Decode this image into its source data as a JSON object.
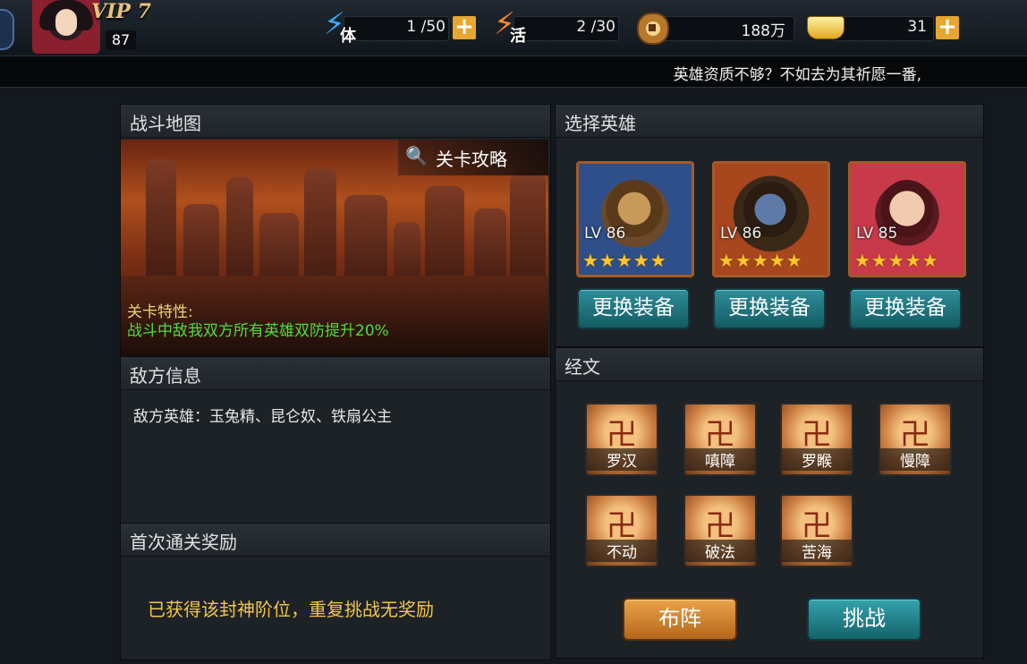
{
  "player": {
    "vip": "VIP 7",
    "level": "87"
  },
  "resources": {
    "stamina": {
      "icon": "体",
      "value": "1 /50"
    },
    "vitality": {
      "icon": "活",
      "value": "2 /30"
    },
    "copper": {
      "value": "188万"
    },
    "gold": {
      "value": "31"
    }
  },
  "marquee": "英雄资质不够？不如去为其祈愿一番,",
  "battle_map": {
    "title": "战斗地图",
    "guide_label": "关卡攻略",
    "trait_label": "关卡特性:",
    "trait_text": "战斗中敌我双方所有英雄双防提升20%"
  },
  "enemy": {
    "title": "敌方信息",
    "text": "敌方英雄：玉兔精、昆仑奴、铁扇公主"
  },
  "reward": {
    "title": "首次通关奖励",
    "text": "已获得该封神阶位，重复挑战无奖励"
  },
  "hero_select": {
    "title": "选择英雄",
    "heroes": [
      {
        "level": "LV 86",
        "stars": 5,
        "equip_label": "更换装备"
      },
      {
        "level": "LV 86",
        "stars": 5,
        "equip_label": "更换装备"
      },
      {
        "level": "LV 85",
        "stars": 5,
        "equip_label": "更换装备"
      }
    ]
  },
  "scripture": {
    "title": "经文",
    "items": [
      "罗汉",
      "嗔障",
      "罗睺",
      "慢障",
      "不动",
      "破法",
      "苦海"
    ]
  },
  "buttons": {
    "formation": "布阵",
    "challenge": "挑战"
  },
  "colors": {
    "trait_label": "#f2d46a",
    "trait_text": "#4fdc3f",
    "star": "#ffc52b",
    "formation_btn": "#d6892c",
    "challenge_btn": "#1d8a95"
  }
}
